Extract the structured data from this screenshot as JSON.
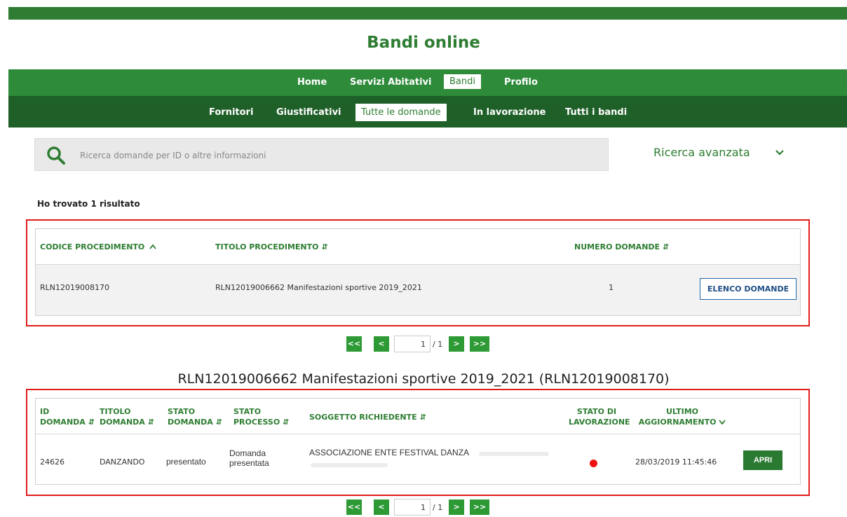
{
  "site": {
    "title": "Bandi online"
  },
  "nav_primary": [
    "Home",
    "Servizi Abitativi",
    "Bandi",
    "Profilo"
  ],
  "nav_secondary": [
    "Fornitori",
    "Giustificativi",
    "Tutte le domande",
    "In lavorazione",
    "Tutti i bandi"
  ],
  "search": {
    "placeholder": "Ricerca domande per ID o altre informazioni",
    "advanced_label": "Ricerca avanzata"
  },
  "results": {
    "count_text": "Ho trovato 1 risultato"
  },
  "procedures_table": {
    "headers": [
      "CODICE PROCEDIMENTO",
      "TITOLO PROCEDIMENTO",
      "NUMERO DOMANDE"
    ],
    "rows": [
      {
        "codice": "RLN12019008170",
        "titolo": "RLN12019006662 Manifestazioni sportive 2019_2021",
        "numero": "1",
        "button": "ELENCO DOMANDE"
      }
    ]
  },
  "pager1": {
    "first": "<<",
    "prev": "<",
    "page": "1",
    "total": "/ 1",
    "next": ">",
    "last": ">>"
  },
  "section": {
    "title": "RLN12019006662 Manifestazioni sportive 2019_2021 (RLN12019008170)"
  },
  "applications_table": {
    "headers": {
      "id": [
        "ID",
        "DOMANDA"
      ],
      "titolo": [
        "TITOLO",
        "DOMANDA"
      ],
      "stato": [
        "STATO",
        "DOMANDA"
      ],
      "processo": [
        "STATO",
        "PROCESSO"
      ],
      "soggetto": [
        "SOGGETTO RICHIEDENTE"
      ],
      "lavorazione": [
        "STATO DI",
        "LAVORAZIONE"
      ],
      "aggiornamento": [
        "ULTIMO",
        "AGGIORNAMENTO"
      ]
    },
    "rows": [
      {
        "id": "24626",
        "titolo": "DANZANDO",
        "stato": "presentato",
        "processo": [
          "Domanda",
          "presentata"
        ],
        "soggetto": "ASSOCIAZIONE ENTE FESTIVAL DANZA",
        "lavorazione_color": "#ee1111",
        "aggiornamento": "28/03/2019 11:45:46",
        "button": "APRI"
      }
    ]
  },
  "pager2": {
    "first": "<<",
    "prev": "<",
    "page": "1",
    "total": "/ 1",
    "next": ">",
    "last": ">>"
  },
  "colors": {
    "brand_green": "#2e7d32",
    "nav_dark": "#1f5f28",
    "highlight_red": "#e21b1b"
  }
}
